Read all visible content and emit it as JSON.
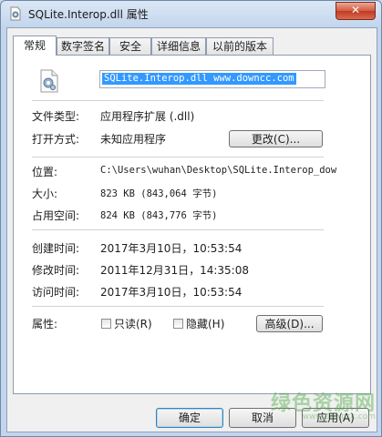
{
  "window": {
    "title": "SQLite.Interop.dll 属性",
    "close_label": "✕"
  },
  "tabs": [
    {
      "label": "常规",
      "active": true
    },
    {
      "label": "数字签名"
    },
    {
      "label": "安全"
    },
    {
      "label": "详细信息"
    },
    {
      "label": "以前的版本"
    }
  ],
  "general": {
    "file_name": "SQLite.Interop.dll  www.downcc.com",
    "type_label": "文件类型:",
    "type_value": "应用程序扩展 (.dll)",
    "opens_label": "打开方式:",
    "opens_value": "未知应用程序",
    "change_button": "更改(C)...",
    "location_label": "位置:",
    "location_value": "C:\\Users\\wuhan\\Desktop\\SQLite.Interop_dow",
    "size_label": "大小:",
    "size_value": "823 KB (843,064 字节)",
    "disk_label": "占用空间:",
    "disk_value": "824 KB (843,776 字节)",
    "created_label": "创建时间:",
    "created_value": "2017年3月10日，10:53:54",
    "modified_label": "修改时间:",
    "modified_value": "2011年12月31日，14:35:08",
    "accessed_label": "访问时间:",
    "accessed_value": "2017年3月10日，10:53:54",
    "attributes_label": "属性:",
    "readonly_label": "只读(R)",
    "hidden_label": "隐藏(H)",
    "advanced_button": "高级(D)..."
  },
  "footer": {
    "ok_button": "确定",
    "cancel_button": "取消",
    "apply_button": "应用(A)"
  },
  "watermark": {
    "main": "绿色资源网",
    "sub": "www.downcc.com"
  },
  "colors": {
    "selection": "#3399ff",
    "close_button": "#c23a22",
    "title_bar": "#c2d5ec"
  }
}
